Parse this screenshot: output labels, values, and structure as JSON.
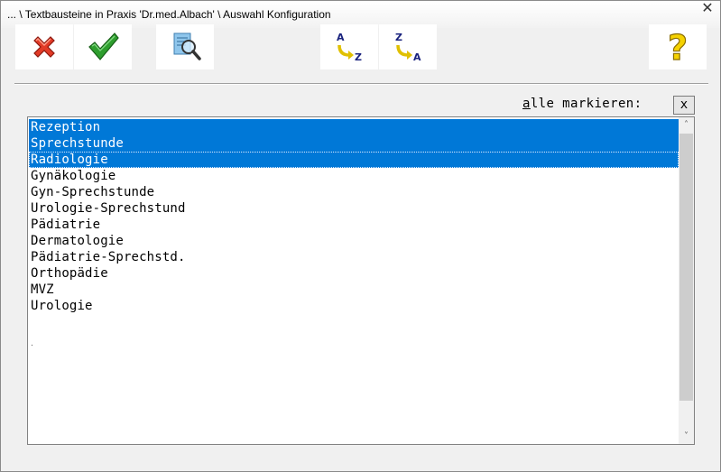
{
  "window": {
    "title": "... \\ Textbausteine in Praxis 'Dr.med.Albach' \\ Auswahl Konfiguration",
    "close_label": "✕"
  },
  "toolbar": {
    "cancel_icon": "red-x-icon",
    "ok_icon": "green-checkmark-icon",
    "search_icon": "magnifier-document-icon",
    "sort_asc_icon": "sort-a-z-icon",
    "sort_desc_icon": "sort-z-a-icon",
    "help_icon": "yellow-question-mark-icon",
    "sort_asc": {
      "top_letter": "A",
      "bottom_letter": "Z"
    },
    "sort_desc": {
      "top_letter": "Z",
      "bottom_letter": "A"
    },
    "help_glyph": "?"
  },
  "mark_all": {
    "label_accel": "a",
    "label_rest": "lle markieren:",
    "box_text": "x"
  },
  "list": {
    "items": [
      {
        "label": "Rezeption",
        "selected": true
      },
      {
        "label": "Sprechstunde",
        "selected": true
      },
      {
        "label": "Radiologie",
        "selected": true
      },
      {
        "label": "Gynäkologie",
        "selected": false
      },
      {
        "label": "Gyn-Sprechstunde",
        "selected": false
      },
      {
        "label": "Urologie-Sprechstund",
        "selected": false
      },
      {
        "label": "Pädiatrie",
        "selected": false
      },
      {
        "label": "Dermatologie",
        "selected": false
      },
      {
        "label": "Pädiatrie-Sprechstd.",
        "selected": false
      },
      {
        "label": "Orthopädie",
        "selected": false
      },
      {
        "label": "MVZ",
        "selected": false
      },
      {
        "label": "Urologie",
        "selected": false
      }
    ],
    "selection_color": "#0078d7"
  },
  "scrollbar": {
    "up_arrow": "˄",
    "down_arrow": "˅"
  }
}
